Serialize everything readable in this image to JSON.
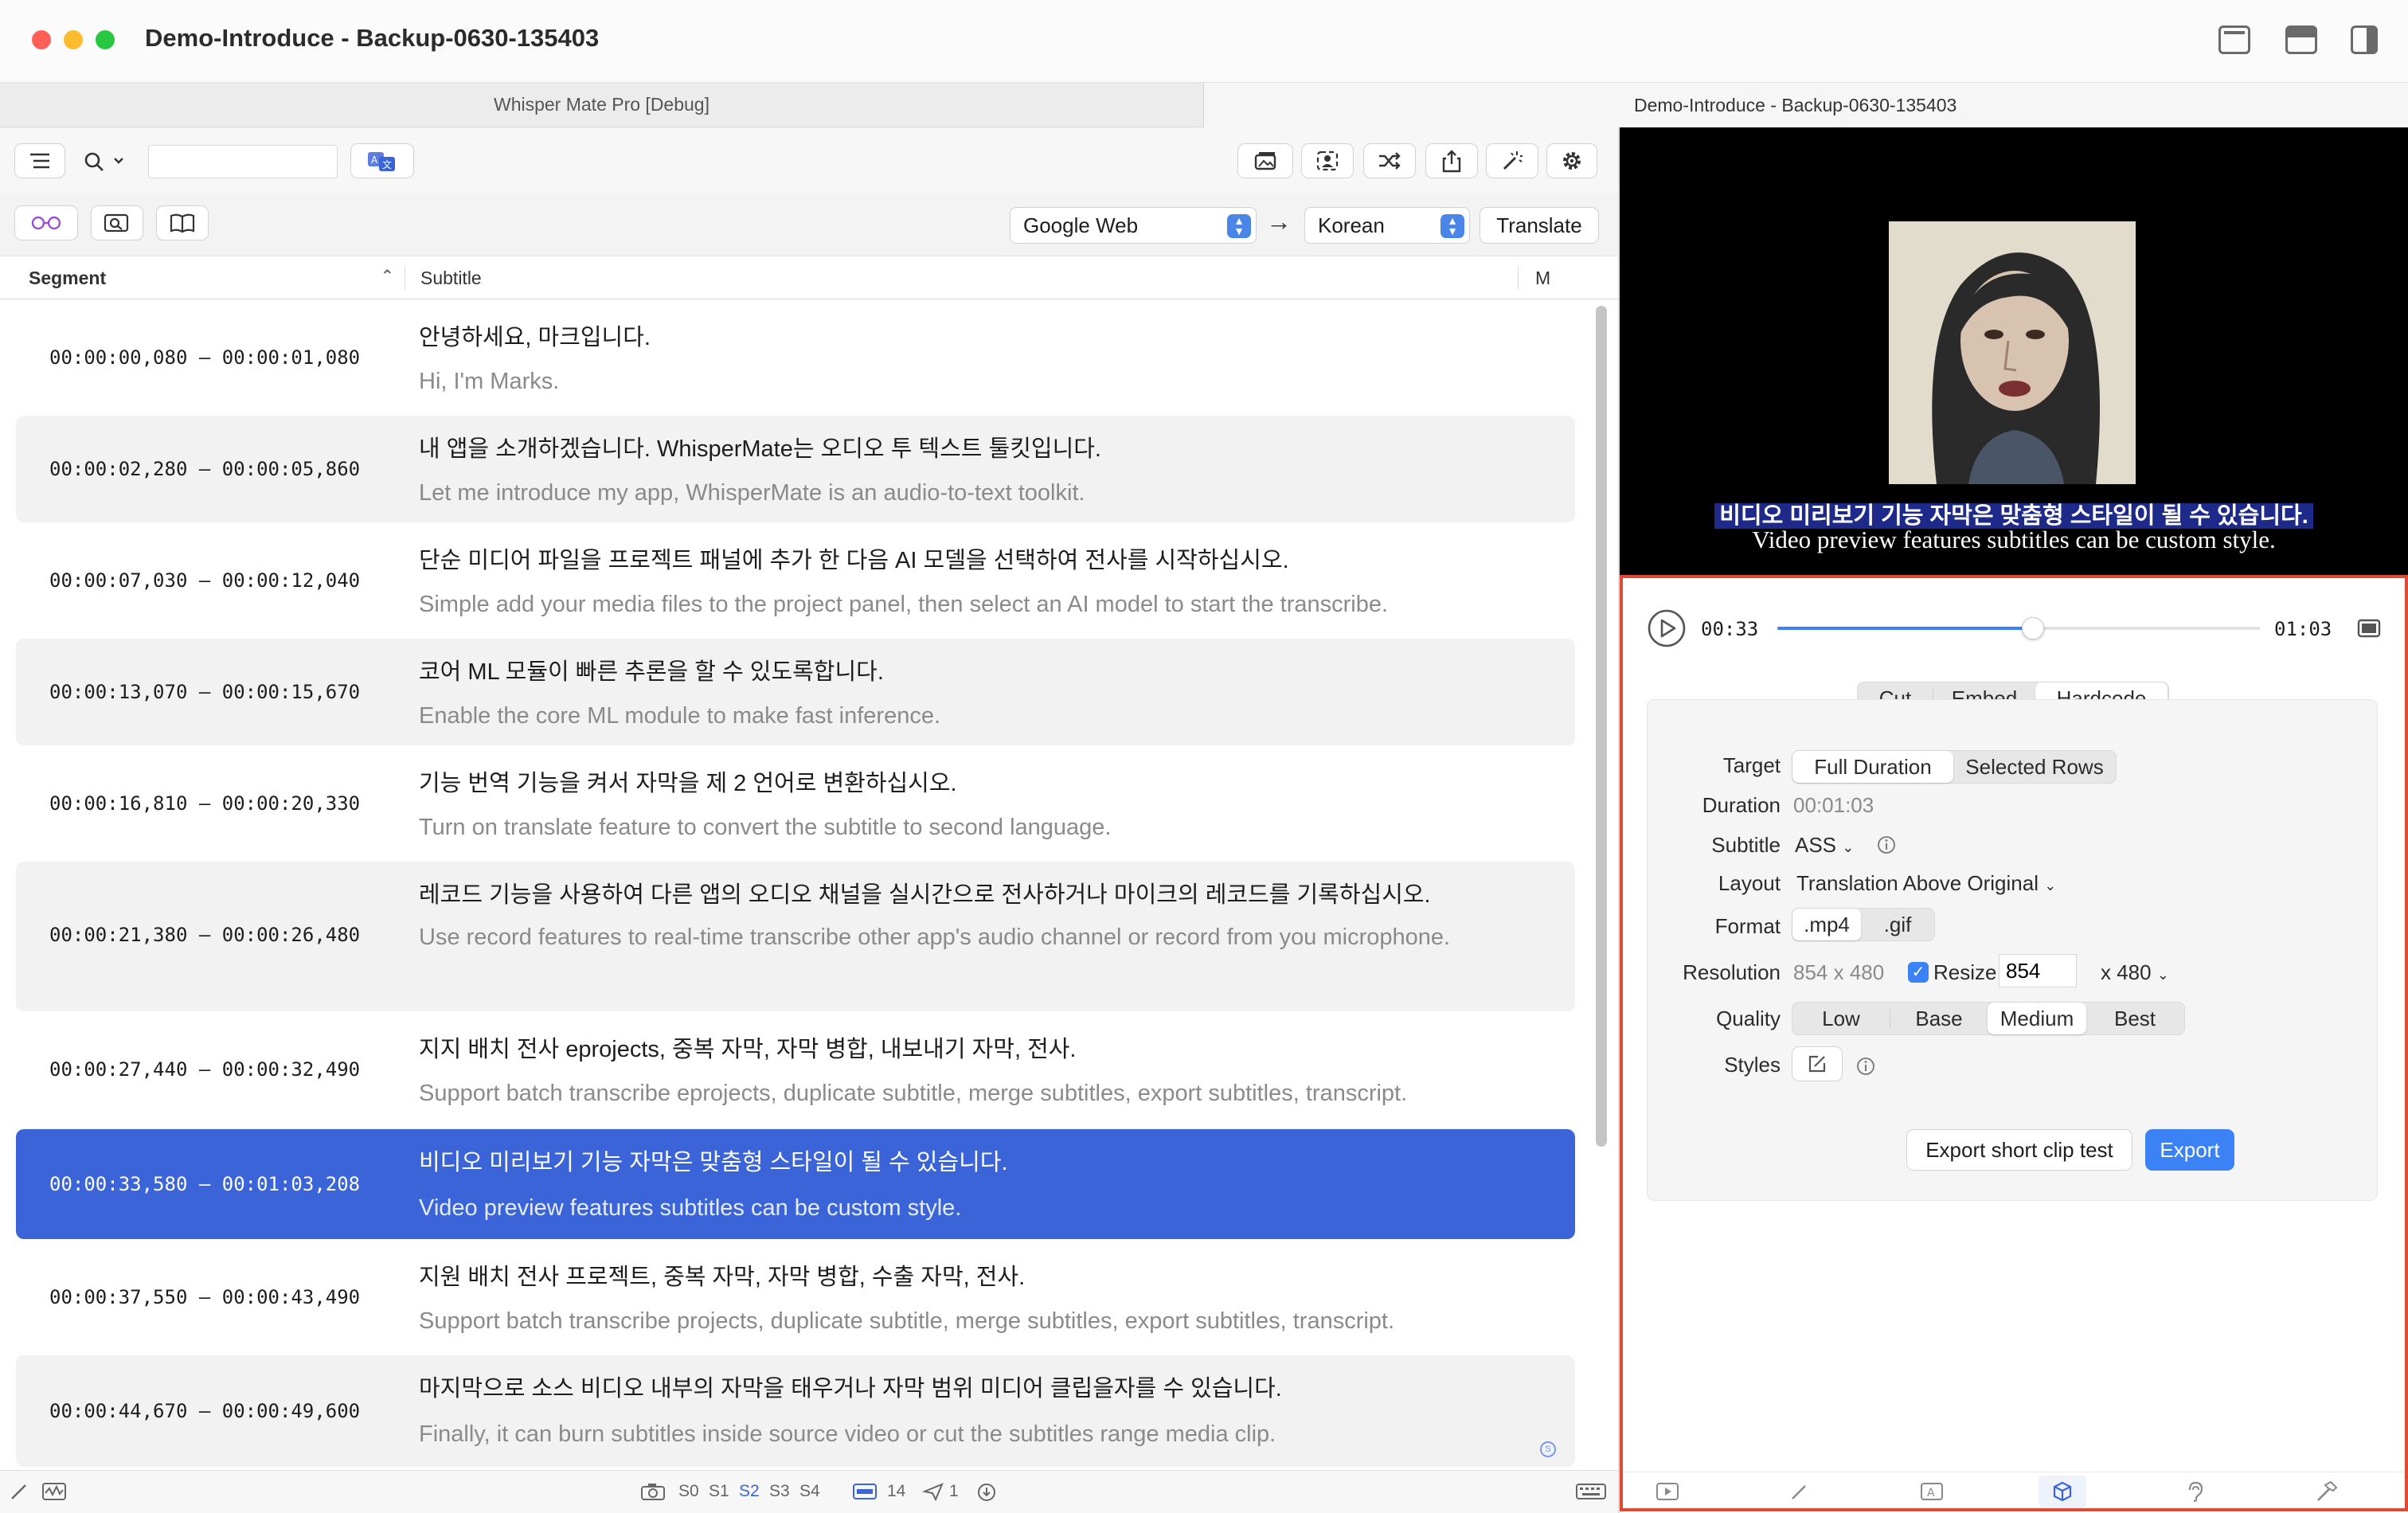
{
  "window": {
    "title": "Demo-Introduce - Backup-0630-135403",
    "traffic_colors": [
      "#ff5f57",
      "#febc2e",
      "#28c840"
    ]
  },
  "tabs": {
    "left": "Whisper Mate Pro [Debug]",
    "right": "Demo-Introduce - Backup-0630-135403"
  },
  "toolbar": {
    "search_value": "",
    "translation": {
      "engine": "Google Web",
      "arrow": "→",
      "language": "Korean",
      "translate_label": "Translate"
    }
  },
  "table": {
    "headers": {
      "segment": "Segment",
      "subtitle": "Subtitle",
      "m": "M"
    },
    "rows": [
      {
        "time": "00:00:00,080 – 00:00:01,080",
        "ko": "안녕하세요, 마크입니다.",
        "en": "Hi, I'm Marks."
      },
      {
        "time": "00:00:02,280 – 00:00:05,860",
        "ko": "내 앱을 소개하겠습니다. WhisperMate는 오디오 투 텍스트 툴킷입니다.",
        "en": "Let me introduce my app, WhisperMate is an audio-to-text toolkit."
      },
      {
        "time": "00:00:07,030 – 00:00:12,040",
        "ko": "단순 미디어 파일을 프로젝트 패널에 추가 한 다음 AI 모델을 선택하여 전사를 시작하십시오.",
        "en": "Simple add your media files to the project panel, then select an AI model to start the transcribe."
      },
      {
        "time": "00:00:13,070 – 00:00:15,670",
        "ko": "코어 ML 모듈이 빠른 추론을 할 수 있도록합니다.",
        "en": "Enable the core ML module to make fast inference."
      },
      {
        "time": "00:00:16,810 – 00:00:20,330",
        "ko": "기능 번역 기능을 켜서 자막을 제 2 언어로 변환하십시오.",
        "en": "Turn on translate feature to convert the subtitle to second language."
      },
      {
        "time": "00:00:21,380 – 00:00:26,480",
        "ko": "레코드 기능을 사용하여 다른 앱의 오디오 채널을 실시간으로 전사하거나 마이크의 레코드를 기록하십시오.",
        "en": "Use record features to real-time transcribe other app's audio channel or record from you microphone."
      },
      {
        "time": "00:00:27,440 – 00:00:32,490",
        "ko": "지지 배치 전사 eprojects, 중복 자막, 자막 병합, 내보내기 자막, 전사.",
        "en": "Support batch transcribe eprojects, duplicate subtitle, merge subtitles, export subtitles, transcript."
      },
      {
        "time": "00:00:33,580 – 00:01:03,208",
        "ko": "비디오 미리보기 기능 자막은 맞춤형 스타일이 될 수 있습니다.",
        "en": "Video preview features subtitles can be custom style.",
        "selected": true
      },
      {
        "time": "00:00:37,550 – 00:00:43,490",
        "ko": "지원 배치 전사 프로젝트, 중복 자막, 자막 병합, 수출 자막, 전사.",
        "en": "Support batch transcribe projects, duplicate subtitle, merge subtitles, export subtitles, transcript."
      },
      {
        "time": "00:00:44,670 – 00:00:49,600",
        "ko": "마지막으로 소스 비디오 내부의 자막을 태우거나 자막 범위 미디어 클립을자를 수 있습니다.",
        "en": "Finally, it can burn subtitles inside source video or cut the subtitles range media clip."
      }
    ]
  },
  "statusbar": {
    "speakers": [
      "S0",
      "S1",
      "S2",
      "S3",
      "S4"
    ],
    "active_speaker": "S2",
    "count_a": "14",
    "count_b": "1"
  },
  "preview": {
    "subtitle_ko": "비디오 미리보기 기능 자막은 맞춤형 스타일이 될 수 있습니다.",
    "subtitle_en": "Video preview features subtitles can be custom style."
  },
  "player": {
    "current": "00:33",
    "total": "01:03",
    "progress": 0.53
  },
  "export": {
    "modes": [
      "Cut",
      "Embed",
      "Hardcode"
    ],
    "active_mode": "Hardcode",
    "labels": {
      "target": "Target",
      "duration": "Duration",
      "subtitle": "Subtitle",
      "layout": "Layout",
      "format": "Format",
      "resolution": "Resolution",
      "quality": "Quality",
      "styles": "Styles"
    },
    "target_options": [
      "Full Duration",
      "Selected Rows"
    ],
    "target_selected": "Full Duration",
    "duration_value": "00:01:03",
    "subtitle_value": "ASS",
    "layout_value": "Translation Above Original",
    "format_options": [
      ".mp4",
      ".gif"
    ],
    "format_selected": ".mp4",
    "resolution_value": "854 x 480",
    "resize_label": "Resize",
    "resize_checked": true,
    "resize_width": "854",
    "resize_height": "x 480",
    "quality_options": [
      "Low",
      "Base",
      "Medium",
      "Best"
    ],
    "quality_selected": "Medium",
    "export_test_label": "Export short clip test",
    "export_label": "Export"
  },
  "colors": {
    "accent": "#3b82f6",
    "selected_row": "#3a64d8",
    "highlight_border": "#e04a33"
  }
}
